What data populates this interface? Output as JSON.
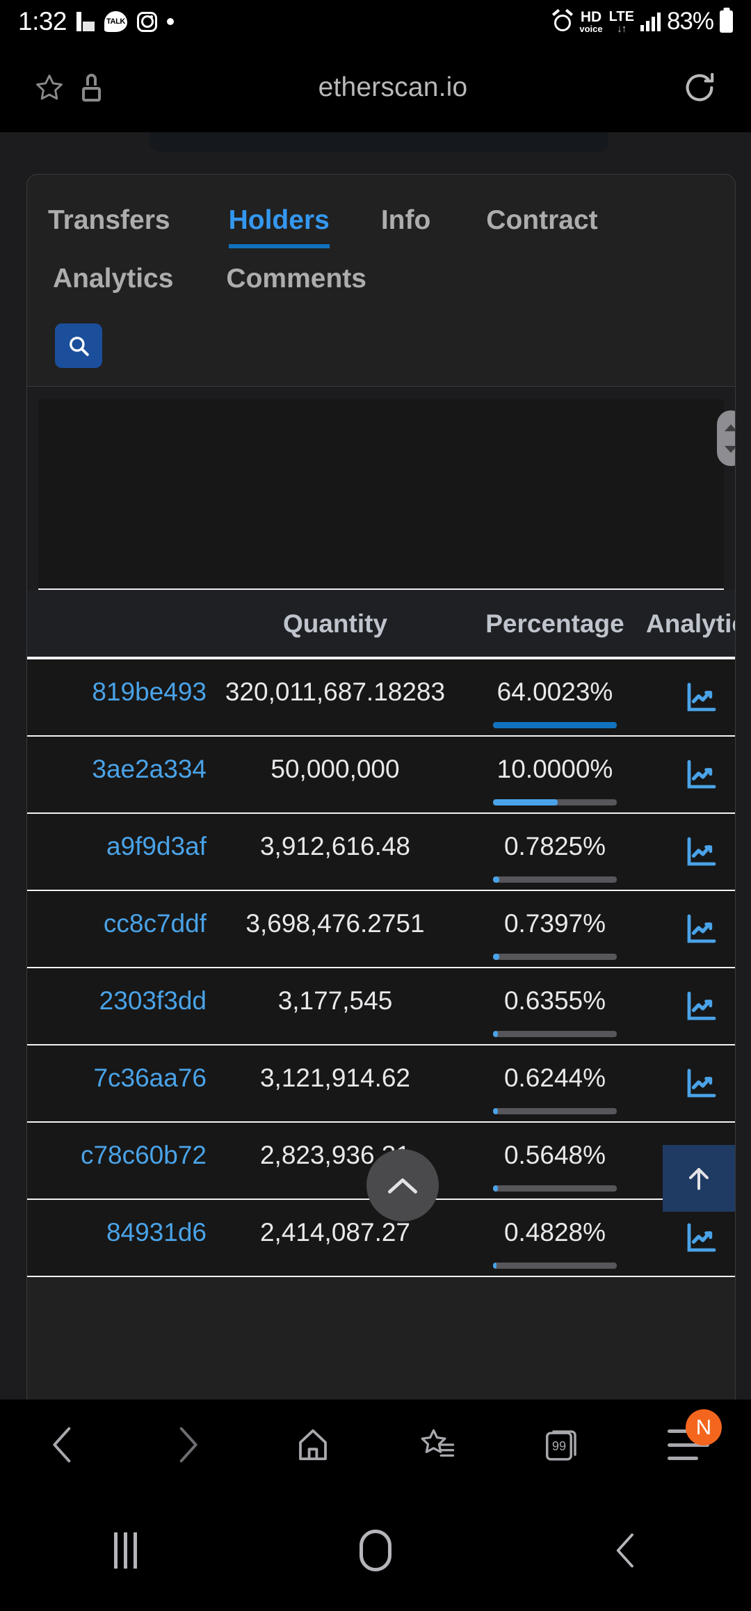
{
  "statusbar": {
    "time": "1:32",
    "icons_left": [
      "linkedin-icon",
      "kakaotalk-icon",
      "instagram-icon",
      "dot-icon"
    ],
    "talk_label": "TALK",
    "alarm": "alarm-icon",
    "hd_top": "HD",
    "hd_bottom": "voice",
    "lte_top": "LTE",
    "lte_bottom": "↓↑",
    "battery_percent": "83%"
  },
  "browserbar": {
    "star_icon": "star-icon",
    "lock_icon": "lock-icon",
    "url": "etherscan.io",
    "reload_icon": "reload-icon"
  },
  "tabs": {
    "row1": [
      {
        "label": "Transfers",
        "active": false
      },
      {
        "label": "Holders",
        "active": true
      },
      {
        "label": "Info",
        "active": false
      },
      {
        "label": "Contract",
        "active": false
      }
    ],
    "row2": [
      {
        "label": "Analytics",
        "active": false
      },
      {
        "label": "Comments",
        "active": false
      }
    ]
  },
  "search": {
    "icon": "search-icon",
    "button_color": "#1b4f9c"
  },
  "table": {
    "headers": [
      "",
      "Quantity",
      "Percentage",
      "Analytics"
    ],
    "rows": [
      {
        "address": "819be493",
        "quantity": "320,011,687.18283",
        "percentage": "64.0023%",
        "bar_pct": 100,
        "bar_style": "full",
        "analytics_icon": "chart-icon"
      },
      {
        "address": "3ae2a334",
        "quantity": "50,000,000",
        "percentage": "10.0000%",
        "bar_pct": 52,
        "bar_style": "normal",
        "analytics_icon": "chart-icon"
      },
      {
        "address": "a9f9d3af",
        "quantity": "3,912,616.48",
        "percentage": "0.7825%",
        "bar_pct": 5,
        "bar_style": "normal",
        "analytics_icon": "chart-icon"
      },
      {
        "address": "cc8c7ddf",
        "quantity": "3,698,476.2751",
        "percentage": "0.7397%",
        "bar_pct": 5,
        "bar_style": "normal",
        "analytics_icon": "chart-icon"
      },
      {
        "address": "2303f3dd",
        "quantity": "3,177,545",
        "percentage": "0.6355%",
        "bar_pct": 4,
        "bar_style": "normal",
        "analytics_icon": "chart-icon"
      },
      {
        "address": "7c36aa76",
        "quantity": "3,121,914.62",
        "percentage": "0.6244%",
        "bar_pct": 4,
        "bar_style": "normal",
        "analytics_icon": "chart-icon"
      },
      {
        "address": "c78c60b72",
        "quantity": "2,823,936.31",
        "percentage": "0.5648%",
        "bar_pct": 4,
        "bar_style": "normal",
        "analytics_icon": "chart-icon"
      },
      {
        "address": "84931d6",
        "quantity": "2,414,087.27",
        "percentage": "0.4828%",
        "bar_pct": 3,
        "bar_style": "normal",
        "analytics_icon": "chart-icon"
      }
    ]
  },
  "floating": {
    "scroll_top_icon": "chevron-up-icon",
    "jump_up_icon": "arrow-up-icon"
  },
  "bottomnav": {
    "items": [
      {
        "name": "back-icon"
      },
      {
        "name": "forward-icon"
      },
      {
        "name": "home-icon"
      },
      {
        "name": "bookmarks-icon"
      },
      {
        "name": "tabs-icon",
        "count": "99"
      },
      {
        "name": "menu-icon",
        "badge": "N"
      }
    ]
  },
  "androidnav": {
    "recents_icon": "recents-icon",
    "home_icon": "home-circle-icon",
    "back_icon": "back-chevron-icon"
  }
}
